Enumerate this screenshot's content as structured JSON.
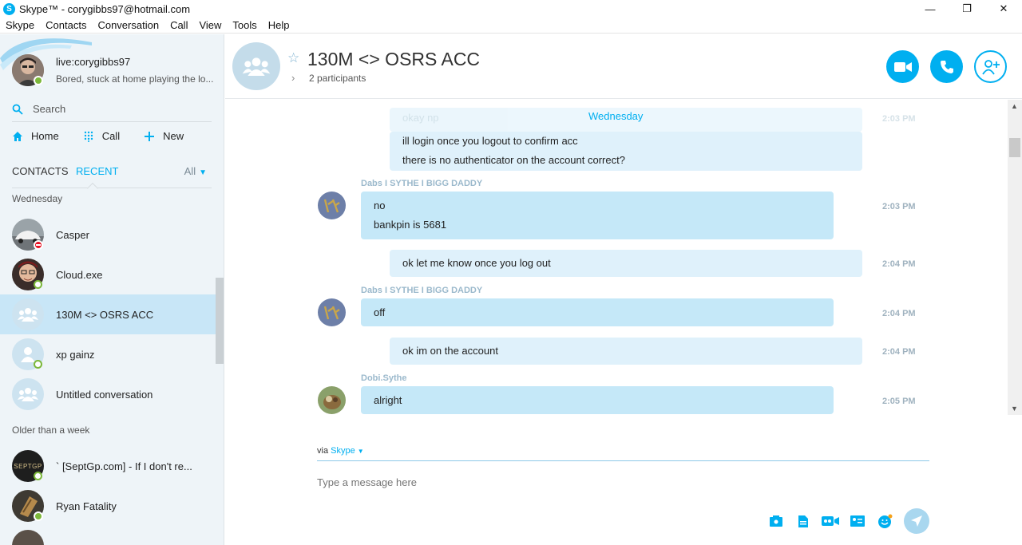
{
  "window": {
    "title": "Skype™ - corygibbs97@hotmail.com",
    "minimize": "—",
    "restore": "❐",
    "close": "✕"
  },
  "menu": [
    "Skype",
    "Contacts",
    "Conversation",
    "Call",
    "View",
    "Tools",
    "Help"
  ],
  "profile": {
    "name": "live:corygibbs97",
    "mood": "Bored, stuck at home playing the lo...",
    "status": "online"
  },
  "sidebar": {
    "search_label": "Search",
    "nav": {
      "home": "Home",
      "call": "Call",
      "new": "New"
    },
    "tabs": {
      "contacts": "CONTACTS",
      "recent": "RECENT",
      "filter": "All"
    },
    "sections": {
      "wednesday": "Wednesday",
      "older": "Older than a week"
    },
    "contacts": [
      {
        "name": "Casper",
        "status": "dnd"
      },
      {
        "name": "Cloud.exe",
        "status": "online-ring"
      },
      {
        "name": "130M <> OSRS ACC",
        "status": "none",
        "selected": true
      },
      {
        "name": "xp gainz",
        "status": "online-ring"
      },
      {
        "name": "Untitled conversation",
        "status": "none"
      },
      {
        "name": "` [SeptGp.com] - If I don't re...",
        "status": "online-ring"
      },
      {
        "name": "Ryan Fatality",
        "status": "online"
      }
    ],
    "sept_avatar_text": "SEPTGP"
  },
  "conversation": {
    "title": "130M <> OSRS ACC",
    "participants": "2 participants",
    "date_separator": "Wednesday",
    "faded_message": "okay np",
    "faded_time": "2:03 PM",
    "messages": [
      {
        "dir": "out",
        "lines": [
          "ill login once you logout to confirm acc",
          "there is no authenticator on the account correct?"
        ],
        "time": ""
      },
      {
        "dir": "in",
        "sender": "Dabs I SYTHE I BIGG DADDY",
        "lines": [
          "no",
          "bankpin is 5681"
        ],
        "time": "2:03 PM"
      },
      {
        "dir": "out",
        "lines": [
          "ok let me know once you log out"
        ],
        "time": "2:04 PM"
      },
      {
        "dir": "in",
        "sender": "Dabs I SYTHE I BIGG DADDY",
        "lines": [
          "off"
        ],
        "time": "2:04 PM"
      },
      {
        "dir": "out",
        "lines": [
          "ok im on the account"
        ],
        "time": "2:04 PM"
      },
      {
        "dir": "in",
        "sender": "Dobi.Sythe",
        "lines": [
          "alright"
        ],
        "time": "2:05 PM"
      }
    ]
  },
  "compose": {
    "via": "via",
    "via_link": "Skype",
    "placeholder": "Type a message here"
  },
  "colors": {
    "accent": "#00aff0",
    "bubble_in": "#c5e8f8",
    "bubble_out": "#dff1fb",
    "sidebar_bg": "#eef4f8"
  }
}
